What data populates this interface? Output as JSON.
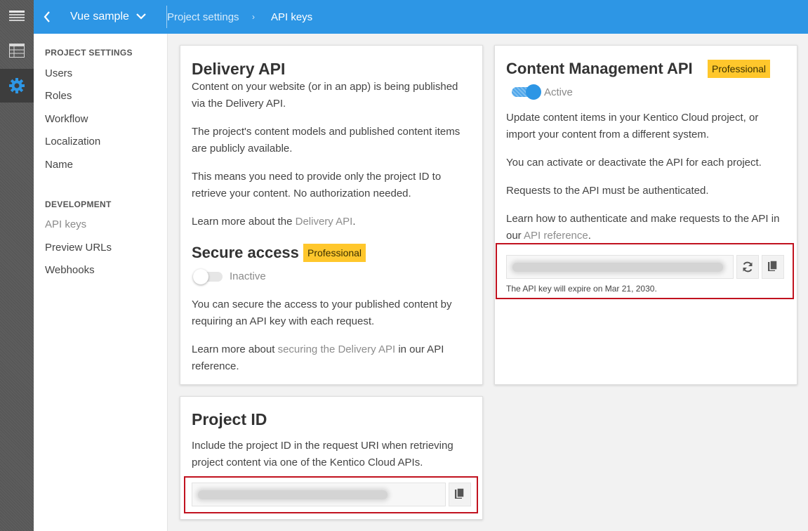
{
  "rail": {
    "items": [
      {
        "icon": "menu-list-icon"
      },
      {
        "icon": "table-grid-icon"
      },
      {
        "icon": "gear-icon",
        "active": true
      }
    ]
  },
  "header": {
    "project_name": "Vue sample",
    "breadcrumb": [
      "Project settings",
      "API keys"
    ],
    "breadcrumb_separator": "›"
  },
  "sidebar": {
    "sections": [
      {
        "heading": "PROJECT SETTINGS",
        "items": [
          "Users",
          "Roles",
          "Workflow",
          "Localization",
          "Name"
        ]
      },
      {
        "heading": "DEVELOPMENT",
        "items": [
          "API keys",
          "Preview URLs",
          "Webhooks"
        ],
        "selected": "API keys"
      }
    ]
  },
  "delivery": {
    "title": "Delivery API",
    "p1": "Content on your website (or in an app) is being published via the Delivery API.",
    "p2": "The project's content models and published content items are publicly available.",
    "p3": "This means you need to provide only the project ID to retrieve your content. No authorization needed.",
    "p4_pre": "Learn more about the ",
    "p4_link": "Delivery API",
    "p4_post": ".",
    "secure": {
      "title": "Secure access",
      "badge": "Professional",
      "toggle_state": "Inactive",
      "p1": "You can secure the access to your published content by requiring an API key with each request.",
      "p2_pre": "Learn more about ",
      "p2_link": "securing the Delivery API",
      "p2_post": " in our API reference."
    }
  },
  "cm": {
    "title": "Content Management API",
    "badge": "Professional",
    "toggle_state": "Active",
    "p1": "Update content items in your Kentico Cloud project, or import your content from a different system.",
    "p2": "You can activate or deactivate the API for each project.",
    "p3": "Requests to the API must be authenticated.",
    "p4_pre": "Learn how to authenticate and make requests to the API in our ",
    "p4_link": "API reference",
    "p4_post": ".",
    "expire_note": "The API key will expire on Mar 21, 2030."
  },
  "project_id": {
    "title": "Project ID",
    "desc": "Include the project ID in the request URI when retrieving project content via one of the Kentico Cloud APIs."
  },
  "colors": {
    "accent": "#2d96e5",
    "badge": "#ffc72c",
    "highlight": "#c1121f"
  }
}
